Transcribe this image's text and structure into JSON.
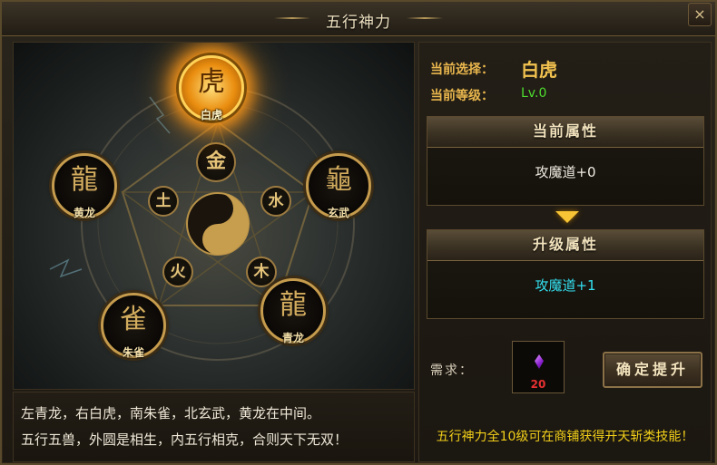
{
  "window": {
    "title": "五行神力",
    "close_glyph": "×"
  },
  "beasts": [
    {
      "key": "baihu",
      "name": "白虎",
      "glyph": "虎",
      "selected": true
    },
    {
      "key": "huanglong",
      "name": "黄龙",
      "glyph": "龍",
      "selected": false
    },
    {
      "key": "xuanwu",
      "name": "玄武",
      "glyph": "龜",
      "selected": false
    },
    {
      "key": "zhuque",
      "name": "朱雀",
      "glyph": "雀",
      "selected": false
    },
    {
      "key": "qinglong",
      "name": "青龙",
      "glyph": "龍",
      "selected": false
    }
  ],
  "elements": [
    "金",
    "水",
    "木",
    "火",
    "土"
  ],
  "description": {
    "line1": "左青龙，右白虎，南朱雀，北玄武，黄龙在中间。",
    "line2": "五行五兽，外圆是相生，内五行相克，合则天下无双！"
  },
  "info": {
    "selected_label": "当前选择：",
    "selected_value": "白虎",
    "level_label": "当前等级：",
    "level_value": "Lv.0"
  },
  "current_attr": {
    "header": "当前属性",
    "value": "攻魔道+0",
    "color": "#f0ece2"
  },
  "upgrade_attr": {
    "header": "升级属性",
    "value": "攻魔道+1",
    "color": "#33e0f0"
  },
  "requirement": {
    "label": "需求：",
    "item_icon": "purple-gem-icon",
    "item_count": "20"
  },
  "confirm_button": "确定提升",
  "tip": "五行神力全10级可在商铺获得开天斩类技能！",
  "colors": {
    "gold": "#e8b64d",
    "level_green": "#4ddc2e",
    "tip_yellow": "#f3d019",
    "upgrade_cyan": "#33e0f0"
  }
}
